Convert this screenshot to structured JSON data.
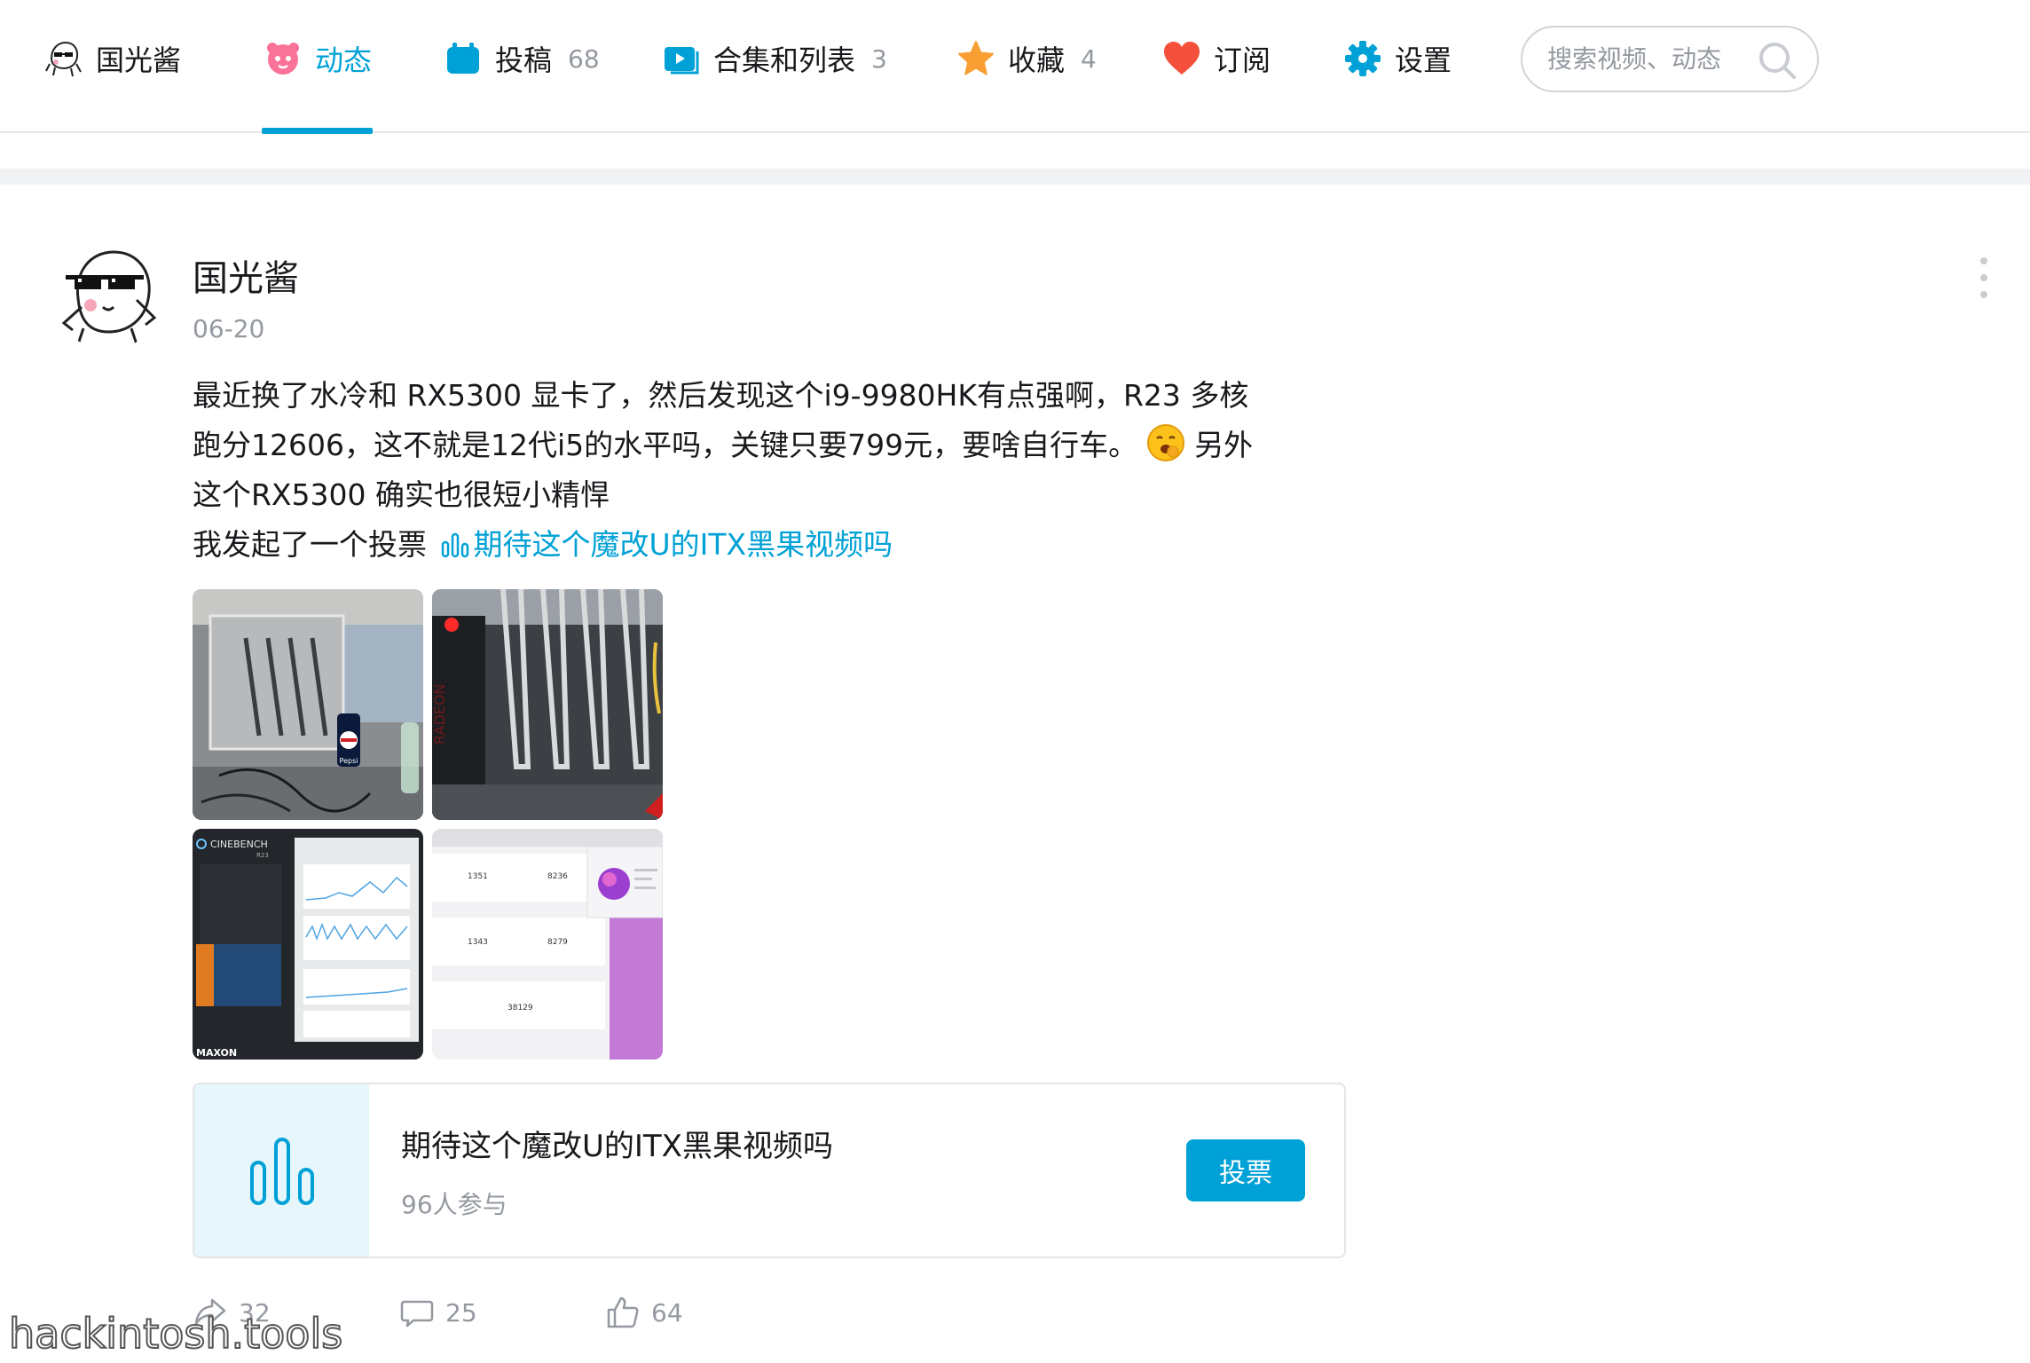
{
  "nav": {
    "items": [
      {
        "label": "国光酱",
        "count": "",
        "icon": "user-avatar-icon"
      },
      {
        "label": "动态",
        "count": "",
        "icon": "dynamic-icon",
        "active": true
      },
      {
        "label": "投稿",
        "count": "68",
        "icon": "submission-icon"
      },
      {
        "label": "合集和列表",
        "count": "3",
        "icon": "collection-icon"
      },
      {
        "label": "收藏",
        "count": "4",
        "icon": "favorite-star-icon"
      },
      {
        "label": "订阅",
        "count": "",
        "icon": "heart-icon"
      },
      {
        "label": "设置",
        "count": "",
        "icon": "settings-gear-icon"
      }
    ],
    "search_placeholder": "搜索视频、动态"
  },
  "post": {
    "author": "国光酱",
    "date": "06-20",
    "text_lines": [
      "最近换了水冷和 RX5300 显卡了，然后发现这个i9-9980HK有点强啊，R23 多核",
      "跑分12606，这不就是12代i5的水平吗，关键只要799元，要啥自行车。",
      "另外",
      "这个RX5300 确实也很短小精悍",
      "我发起了一个投票",
      "期待这个魔改U的ITX黑果视频吗"
    ],
    "images": [
      {
        "name": "photo-itx-case-pepsi",
        "label": "Pepsi"
      },
      {
        "name": "photo-radeon-gpu",
        "label": "RADEON"
      },
      {
        "name": "photo-cinebench-screenshot",
        "label": "CINEBENCH",
        "sub": "R23",
        "brand": "MAXON"
      },
      {
        "name": "photo-geekbench-screenshot",
        "scores": [
          "1351",
          "8236",
          "1343",
          "8279",
          "38129"
        ]
      }
    ]
  },
  "vote_card": {
    "title": "期待这个魔改U的ITX黑果视频吗",
    "participants": "96人参与",
    "button": "投票"
  },
  "actions": {
    "forward": "32",
    "comment": "25",
    "like": "64"
  },
  "watermark": "hackintosh.tools",
  "colors": {
    "accent": "#00a1d6",
    "muted": "#9499a0",
    "text": "#18191c"
  }
}
